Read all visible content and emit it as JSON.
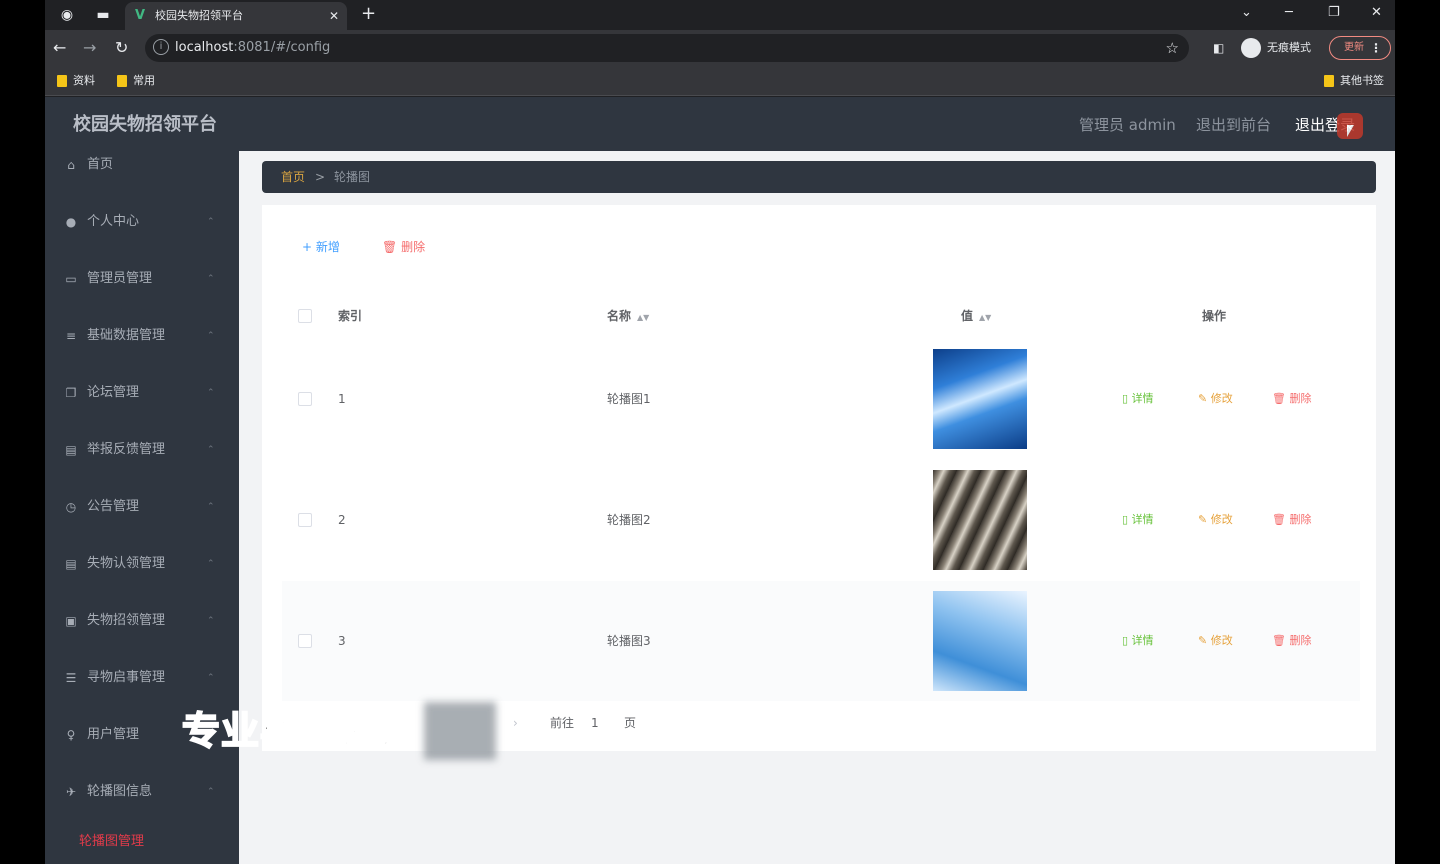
{
  "browser": {
    "tab_title": "校园失物招领平台",
    "url_host": "localhost",
    "url_rest": ":8081/#/config",
    "profile_label": "无痕模式",
    "update_label": "更新",
    "bookmarks": [
      "资料",
      "常用"
    ],
    "other_bookmarks": "其他书签"
  },
  "header": {
    "brand": "校园失物招领平台",
    "admin_label": "管理员 admin",
    "back_to_front": "退出到前台",
    "logout": "退出登录"
  },
  "sidebar": {
    "items": [
      {
        "label": "首页",
        "icon": "home-icon",
        "glyph": "⌂"
      },
      {
        "label": "个人中心",
        "icon": "user-icon",
        "glyph": "●"
      },
      {
        "label": "管理员管理",
        "icon": "board-icon",
        "glyph": "▭"
      },
      {
        "label": "基础数据管理",
        "icon": "stack-icon",
        "glyph": "≡"
      },
      {
        "label": "论坛管理",
        "icon": "copy-icon",
        "glyph": "❐"
      },
      {
        "label": "举报反馈管理",
        "icon": "doc-icon",
        "glyph": "▤"
      },
      {
        "label": "公告管理",
        "icon": "clock-icon",
        "glyph": "◷"
      },
      {
        "label": "失物认领管理",
        "icon": "doc-icon",
        "glyph": "▤"
      },
      {
        "label": "失物招领管理",
        "icon": "card-icon",
        "glyph": "▣"
      },
      {
        "label": "寻物启事管理",
        "icon": "list-icon",
        "glyph": "☰"
      },
      {
        "label": "用户管理",
        "icon": "mic-icon",
        "glyph": "♀"
      },
      {
        "label": "轮播图信息",
        "icon": "send-icon",
        "glyph": "✈"
      }
    ],
    "active_sub": "轮播图管理"
  },
  "breadcrumb": {
    "home": "首页",
    "separator": ">",
    "current": "轮播图"
  },
  "actions": {
    "add": "+ 新增",
    "delete": "删除"
  },
  "table": {
    "headers": {
      "index": "索引",
      "name": "名称",
      "value": "值",
      "ops": "操作"
    },
    "rows": [
      {
        "index": "1",
        "name": "轮播图1"
      },
      {
        "index": "2",
        "name": "轮播图2"
      },
      {
        "index": "3",
        "name": "轮播图3"
      }
    ],
    "ops": {
      "detail": "详情",
      "edit": "修改",
      "remove": "删除"
    }
  },
  "pager": {
    "goto": "前往",
    "page": "1",
    "unit": "页"
  },
  "watermark": "专业毕业设计",
  "colors": {
    "accent": "#409eff",
    "danger": "#f56c6c",
    "success": "#67c23a",
    "warning": "#e6a23c",
    "sidebar": "#2f3640",
    "active_menu": "#e23b4a"
  }
}
